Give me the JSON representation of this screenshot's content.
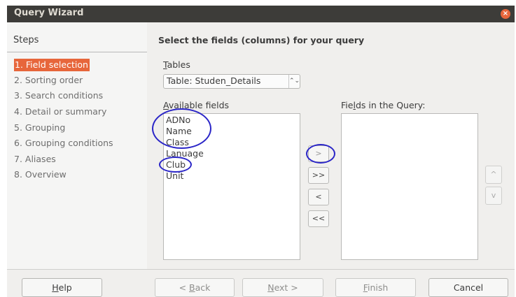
{
  "window": {
    "title": "Query Wizard",
    "close_glyph": "×"
  },
  "sidebar": {
    "title": "Steps",
    "steps": [
      {
        "label": "1. Field selection",
        "active": true
      },
      {
        "label": "2. Sorting order"
      },
      {
        "label": "3. Search conditions"
      },
      {
        "label": "4. Detail or summary"
      },
      {
        "label": "5. Grouping"
      },
      {
        "label": "6. Grouping conditions"
      },
      {
        "label": "7. Aliases"
      },
      {
        "label": "8. Overview"
      }
    ]
  },
  "main": {
    "title": "Select the fields (columns) for your query",
    "tables_label": {
      "first": "T",
      "rest": "ables"
    },
    "table_select": {
      "value": "Table: Studen_Details",
      "arrow": "⌃⌄"
    },
    "available_label": {
      "first": "A",
      "rest": "vailable fields"
    },
    "available_fields": [
      "ADNo",
      "Name",
      "Class",
      "Lanuage",
      "Club",
      "Unit"
    ],
    "query_label": {
      "pre": "Fie",
      "ul": "l",
      "post": "ds in the Query:"
    },
    "query_fields": [],
    "move_buttons": {
      "add": ">",
      "add_all": ">>",
      "remove": "<",
      "remove_all": "<<"
    },
    "order_buttons": {
      "up": "^",
      "down": "v"
    }
  },
  "footer": {
    "help": {
      "ul": "H",
      "rest": "elp"
    },
    "back": {
      "pre": "< ",
      "ul": "B",
      "rest": "ack"
    },
    "next": {
      "ul": "N",
      "rest": "ext >"
    },
    "finish": {
      "ul": "F",
      "rest": "inish"
    },
    "cancel": "Cancel"
  },
  "colors": {
    "accent": "#e7663b",
    "titlebar": "#3d3c39",
    "annotation": "#2a25c7"
  }
}
